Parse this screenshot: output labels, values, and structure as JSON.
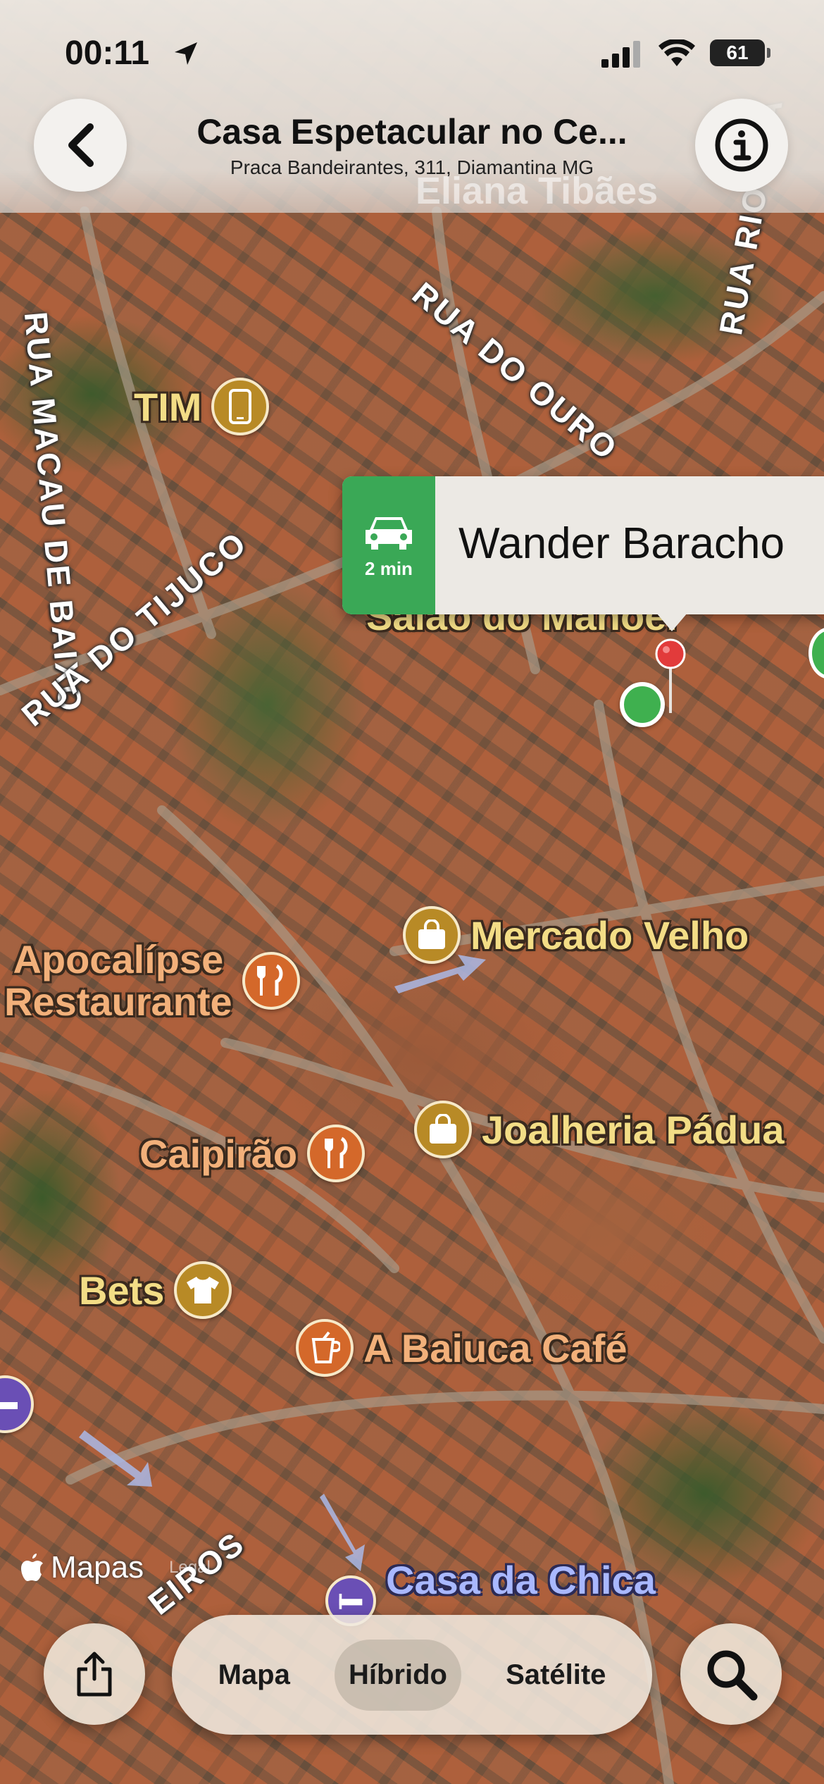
{
  "status_bar": {
    "time": "00:11",
    "battery": "61"
  },
  "header": {
    "title": "Casa Espetacular no Ce...",
    "subtitle": "Praca Bandeirantes, 311, Diamantina MG",
    "faded_label": "Eliana Tibães"
  },
  "streets": {
    "rua_macau": "RUA MACAU DE BAIXO",
    "rua_ouro": "RUA DO OURO",
    "rua_rio": "RUA RIO GRA",
    "rua_tijuco": "RUA DO TIJUCO",
    "rua_bottom": "EIROS"
  },
  "pois": {
    "tim": "TIM",
    "salao": "Salão do Manoel",
    "mercado": "Mercado Velho",
    "apocalipse_line1": "Apocalípse",
    "apocalipse_line2": "Restaurante",
    "joalheria": "Joalheria Pádua",
    "caipirao": "Caipirão",
    "bets": "Bets",
    "baiuca": "A Baiuca Café",
    "chica": "Casa da Chica"
  },
  "callout": {
    "drive_time": "2 min",
    "name": "Wander Baracho"
  },
  "attribution": {
    "maps": "Mapas",
    "legal": "Legal"
  },
  "map_modes": {
    "options": [
      "Mapa",
      "Híbrido",
      "Satélite"
    ],
    "selected": "Híbrido"
  },
  "colors": {
    "drive_green": "#3aa856",
    "poi_gold": "#f3dd86",
    "poi_orange": "#f2b07a"
  }
}
